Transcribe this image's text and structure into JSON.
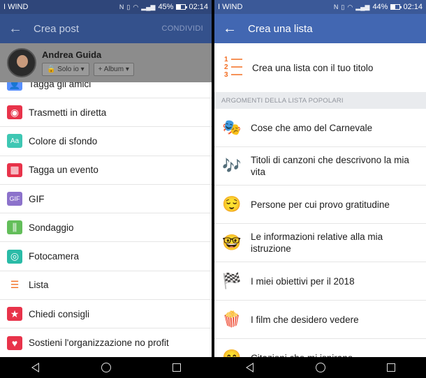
{
  "left": {
    "status": {
      "carrier": "I WIND",
      "battery": "45%",
      "time": "02:14",
      "battery_fill": 0.45
    },
    "appbar": {
      "title": "Crea post",
      "share_label": "CONDIVIDI"
    },
    "composer": {
      "name": "Andrea Guida",
      "privacy_label": "Solo io",
      "album_label": "+ Album"
    },
    "menu": [
      {
        "label": "Tagga gli amici",
        "icon": "person-tag-icon",
        "color": "#5890ff",
        "glyph": "👤"
      },
      {
        "label": "Trasmetti in diretta",
        "icon": "live-video-icon",
        "color": "#e8334a",
        "glyph": "◉"
      },
      {
        "label": "Colore di sfondo",
        "icon": "background-color-icon",
        "color": "#3ec7b3",
        "glyph": "Aa"
      },
      {
        "label": "Tagga un evento",
        "icon": "calendar-icon",
        "color": "#e8334a",
        "glyph": "▦"
      },
      {
        "label": "GIF",
        "icon": "gif-icon",
        "color": "#8c72cb",
        "glyph": "GIF"
      },
      {
        "label": "Sondaggio",
        "icon": "poll-icon",
        "color": "#63be5a",
        "glyph": "⫼"
      },
      {
        "label": "Fotocamera",
        "icon": "camera-icon",
        "color": "#2abba7",
        "glyph": "◎"
      },
      {
        "label": "Lista",
        "icon": "list-icon",
        "color": "#f36d21",
        "glyph": "☰"
      },
      {
        "label": "Chiedi consigli",
        "icon": "ask-recommendations-icon",
        "color": "#e8334a",
        "glyph": "★"
      },
      {
        "label": "Sostieni l'organizzazione no profit",
        "icon": "nonprofit-heart-icon",
        "color": "#e8334a",
        "glyph": "♥"
      }
    ]
  },
  "right": {
    "status": {
      "carrier": "I WIND",
      "battery": "44%",
      "time": "02:14",
      "battery_fill": 0.44
    },
    "appbar": {
      "title": "Crea una lista"
    },
    "create_row": {
      "label": "Crea una lista con il tuo titolo",
      "numbers": [
        "1",
        "2",
        "3"
      ]
    },
    "section_header": "ARGOMENTI DELLA LISTA POPOLARI",
    "topics": [
      {
        "label": "Cose che amo del Carnevale",
        "icon": "carnival-mask-icon",
        "glyph": "🎭"
      },
      {
        "label": "Titoli di canzoni che descrivono la mia vita",
        "icon": "music-notes-icon",
        "glyph": "🎶"
      },
      {
        "label": "Persone per cui provo gratitudine",
        "icon": "grateful-face-icon",
        "glyph": "😌"
      },
      {
        "label": "Le informazioni relative alla mia istruzione",
        "icon": "nerd-face-icon",
        "glyph": "🤓"
      },
      {
        "label": "I miei obiettivi per il 2018",
        "icon": "checkered-flag-icon",
        "glyph": "🏁"
      },
      {
        "label": "I film che desidero vedere",
        "icon": "popcorn-icon",
        "glyph": "🍿"
      },
      {
        "label": "Citazioni che mi ispirano",
        "icon": "inspiration-face-icon",
        "glyph": "😊"
      }
    ]
  },
  "colors": {
    "facebook_blue": "#4267b2",
    "section_bg": "#e9ebee",
    "list_orange": "#f36d21"
  }
}
